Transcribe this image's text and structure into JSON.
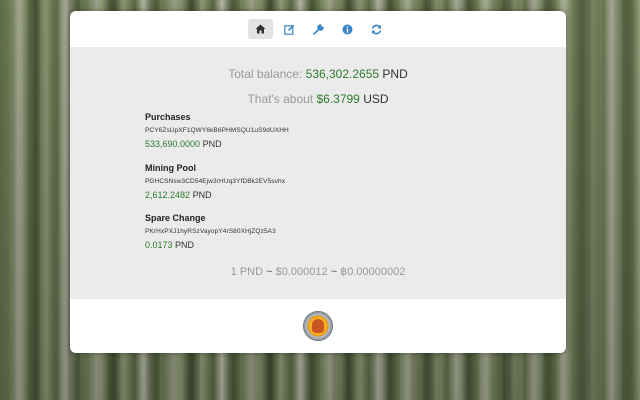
{
  "toolbar": {
    "buttons": [
      {
        "icon": "home-icon",
        "active": true
      },
      {
        "icon": "edit-icon",
        "active": false
      },
      {
        "icon": "wrench-icon",
        "active": false
      },
      {
        "icon": "info-icon",
        "active": false
      },
      {
        "icon": "refresh-icon",
        "active": false
      }
    ]
  },
  "summary": {
    "total_label": "Total balance:",
    "total_value": "536,302.2655",
    "total_unit": "PND",
    "about_label": "That's about",
    "about_value": "$6.3799",
    "about_unit": "USD"
  },
  "wallets": [
    {
      "name": "Purchases",
      "address": "PCY6ZsUpXF1QWY6kB6PHMSQU1uS9dUXHH",
      "balance": "533,690.0000",
      "unit": "PND"
    },
    {
      "name": "Mining Pool",
      "address": "PGHCSNsw3CD54Ejw3rHUq3YfDBk2EV5svhx",
      "balance": "2,612.2482",
      "unit": "PND"
    },
    {
      "name": "Spare Change",
      "address": "PKrHxPXJ1hyRSzVayopY4rS80XHjZQz5A3",
      "balance": "0.0173",
      "unit": "PND"
    }
  ],
  "rate": {
    "pnd": "1 PND",
    "tilde": "~",
    "usd": "$0.000012",
    "btc": "฿0.00000002"
  },
  "colors": {
    "accent": "#3a87c8",
    "balance_green": "#2c7a2c",
    "panel_bg": "#ebebeb"
  }
}
